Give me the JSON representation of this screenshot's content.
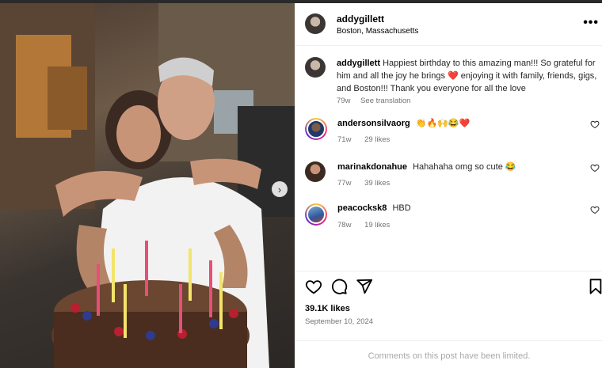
{
  "post": {
    "username": "addygillett",
    "location": "Boston, Massachusetts",
    "more_label": "•••"
  },
  "caption": {
    "username": "addygillett",
    "text": "Happiest birthday to this amazing man!!! So grateful for him and all the joy he brings ❤️ enjoying it with family, friends, gigs, and Boston!!! Thank you everyone for all the love",
    "age": "79w",
    "see_translation": "See translation"
  },
  "comments": [
    {
      "username": "andersonsilvaorg",
      "text": "👏🔥🙌😂❤️",
      "age": "71w",
      "likes": "29 likes"
    },
    {
      "username": "marinakdonahue",
      "text": "Hahahaha omg so cute 😂",
      "age": "77w",
      "likes": "39 likes"
    },
    {
      "username": "peacocksk8",
      "text": "HBD",
      "age": "78w",
      "likes": "19 likes"
    }
  ],
  "stats": {
    "likes": "39.1K likes",
    "date": "September 10, 2024"
  },
  "footer": {
    "limited": "Comments on this post have been limited."
  },
  "icons": {
    "like": "heart-icon",
    "comment": "comment-icon",
    "share": "send-icon",
    "save": "bookmark-icon",
    "next": "chevron-right-icon",
    "more": "more-horizontal-icon"
  },
  "colors": {
    "muted": "#737373",
    "heart": "#ed4956"
  }
}
